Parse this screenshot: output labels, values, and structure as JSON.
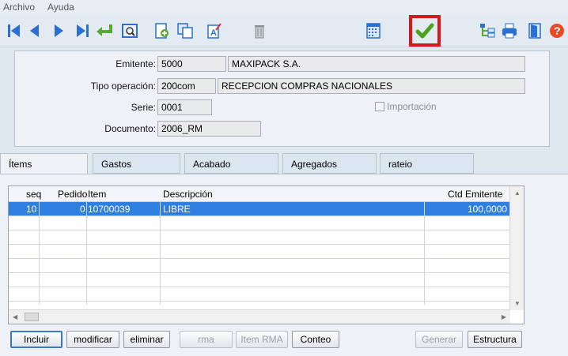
{
  "menu": {
    "items": [
      "Archivo",
      "Ayuda"
    ]
  },
  "toolbar": {
    "icons": [
      "first-record-icon",
      "prev-record-icon",
      "next-record-icon",
      "last-record-icon",
      "return-icon",
      "preview-icon",
      "new-document-icon",
      "copy-icon",
      "edit-text-icon",
      "trash-icon",
      "calendar-icon",
      "confirm-check-icon",
      "tree-icon",
      "print-icon",
      "exit-door-icon",
      "help-icon"
    ],
    "highlight_color": "#d8161b"
  },
  "form": {
    "emitente_label": "Emitente:",
    "emitente_code": "5000",
    "emitente_name": "MAXIPACK S.A.",
    "tipo_label": "Tipo operación:",
    "tipo_code": "200com",
    "tipo_name": "RECEPCION COMPRAS NACIONALES",
    "serie_label": "Serie:",
    "serie_value": "0001",
    "importacion_label": "Importación",
    "documento_label": "Documento:",
    "documento_value": "2006_RM"
  },
  "tabs": [
    "Ítems",
    "Gastos",
    "Acabado",
    "Agregados",
    "rateio"
  ],
  "grid": {
    "headers": {
      "seq": "seq",
      "pedido": "Pedido",
      "item": "Item",
      "descripcion": "Descripción",
      "ctd": "Ctd Emitente"
    },
    "rows": [
      {
        "seq": "10",
        "pedido": "0",
        "item": "10700039",
        "descripcion": "LIBRE",
        "ctd": "100,0000"
      }
    ],
    "selected_color": "#2f7fe0"
  },
  "buttons": {
    "incluir": "Incluir",
    "modificar": "modificar",
    "eliminar": "eliminar",
    "rma": "rma",
    "item_rma": "Item RMA",
    "conteo": "Conteo",
    "generar": "Generar",
    "estructura": "Estructura"
  }
}
